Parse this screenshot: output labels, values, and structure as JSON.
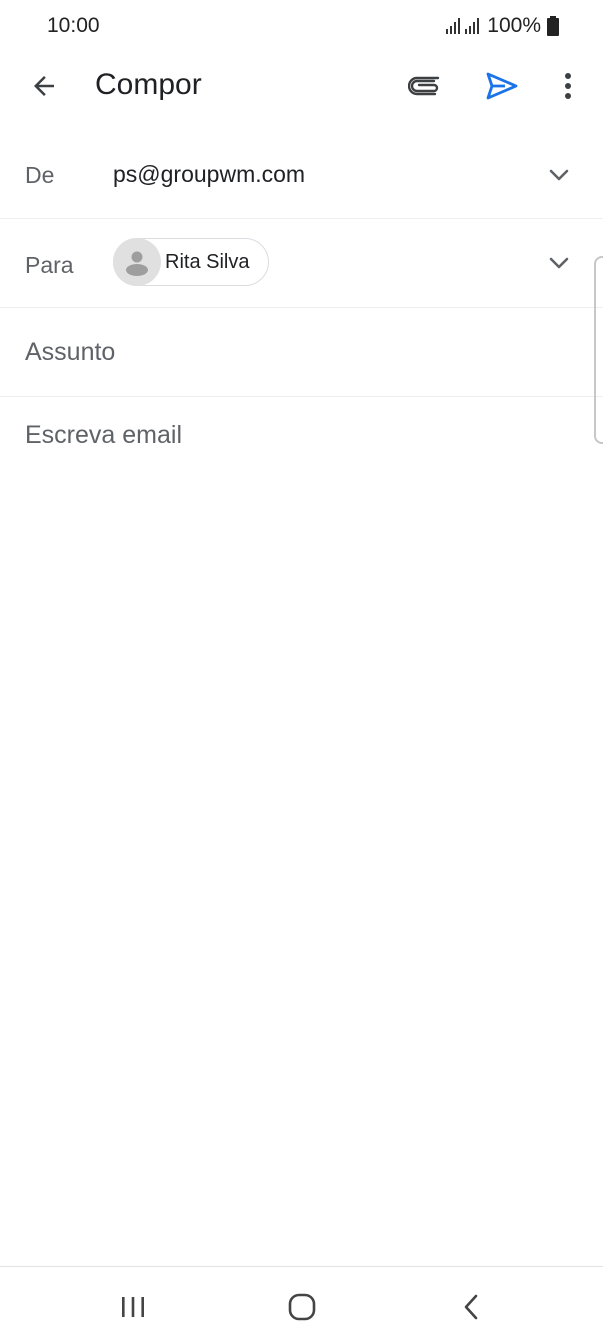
{
  "status_bar": {
    "time": "10:00",
    "battery": "100%"
  },
  "app_bar": {
    "title": "Compor",
    "icons": [
      "arrow-back-icon",
      "attach-icon",
      "send-icon",
      "more-vert-icon"
    ],
    "send_color": "#1a73e8"
  },
  "from": {
    "label": "De",
    "value": "ps@groupwm.com"
  },
  "to": {
    "label": "Para",
    "recipients": [
      {
        "name": "Rita Silva"
      }
    ]
  },
  "subject": {
    "placeholder": "Assunto"
  },
  "body": {
    "placeholder": "Escreva email"
  },
  "nav_bar": {
    "icons": [
      "recents-icon",
      "home-icon",
      "back-icon"
    ]
  }
}
